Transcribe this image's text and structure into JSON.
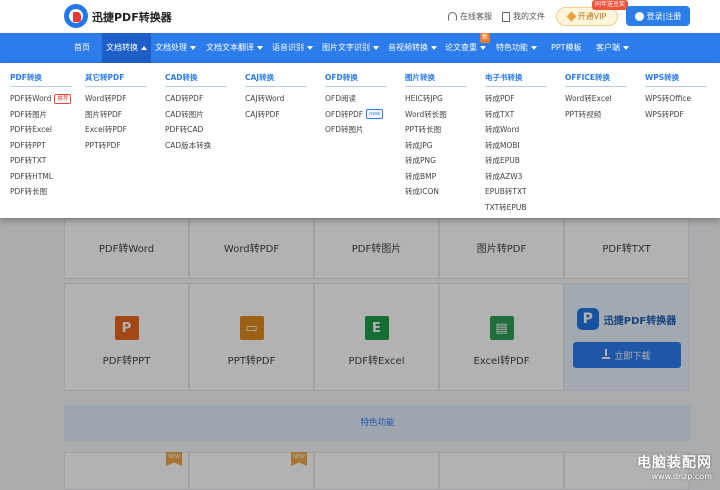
{
  "header": {
    "logo_text": "迅捷PDF转换器",
    "service_label": "在线客服",
    "files_label": "我的文件",
    "vip_label": "开通VIP",
    "vip_tag": "同年送豆奖",
    "login_label": "登录|注册"
  },
  "nav": {
    "items": [
      "首页",
      "文档转换",
      "文档处理",
      "文档文本翻译",
      "语音识别",
      "图片文字识别",
      "音视频转换",
      "论文查重",
      "特色功能",
      "PPT模板",
      "客户端"
    ],
    "new_badge": "新"
  },
  "dropdown": {
    "columns": [
      {
        "title": "PDF转换",
        "items": [
          "PDF转Word",
          "PDF转图片",
          "PDF转Excel",
          "PDF转PPT",
          "PDF转TXT",
          "PDF转HTML",
          "PDF转长图"
        ]
      },
      {
        "title": "其它转PDF",
        "items": [
          "Word转PDF",
          "图片转PDF",
          "Excel转PDF",
          "PPT转PDF"
        ]
      },
      {
        "title": "CAD转换",
        "items": [
          "CAD转PDF",
          "CAD转图片",
          "PDF转CAD",
          "CAD版本转换"
        ]
      },
      {
        "title": "CAJ转换",
        "items": [
          "CAJ转Word",
          "CAJ转PDF"
        ]
      },
      {
        "title": "OFD转换",
        "items": [
          "OFD阅读",
          "OFD转PDF",
          "OFD转图片"
        ]
      },
      {
        "title": "图片转换",
        "items": [
          "HEIC转JPG",
          "Word转长图",
          "PPT转长图",
          "转成JPG",
          "转成PNG",
          "转成BMP",
          "转成ICON"
        ]
      },
      {
        "title": "电子书转换",
        "items": [
          "转成PDF",
          "转成TXT",
          "转成Word",
          "转成MOBI",
          "转成EPUB",
          "转成AZW3",
          "EPUB转TXT",
          "TXT转EPUB"
        ]
      },
      {
        "title": "OFFICE转换",
        "items": [
          "Word转Excel",
          "PPT转视频"
        ]
      },
      {
        "title": "WPS转换",
        "items": [
          "WPS转Office",
          "WPS转PDF"
        ]
      }
    ],
    "hot_tag": "推荐",
    "new_tag": "new"
  },
  "tools": {
    "row1": [
      "PDF转Word",
      "Word转PDF",
      "PDF转图片",
      "图片转PDF",
      "PDF转TXT"
    ],
    "row2": [
      {
        "label": "PDF转PPT",
        "glyph": "P",
        "color": "#e8661f"
      },
      {
        "label": "PPT转PDF",
        "glyph": "▭",
        "color": "#e08a1e"
      },
      {
        "label": "PDF转Excel",
        "glyph": "E",
        "color": "#1e9c4a"
      },
      {
        "label": "Excel转PDF",
        "glyph": "▤",
        "color": "#2f9e57"
      }
    ],
    "row1_colors": [
      "#2d6fd6",
      "#e04a3a",
      "#2aa8e0",
      "#e6a020",
      "#2a9d8f"
    ],
    "bottom_new": "NEW",
    "bottom_colors": [
      "#2aa25a",
      "#2aa8e0",
      "#e8661f",
      "#e6a020",
      "#1e9c4a"
    ]
  },
  "promo": {
    "mark": "P",
    "name": "迅捷PDF转换器",
    "download_label": "立即下载"
  },
  "special_label": "特色功能",
  "watermark": {
    "line1": "电脑装配网",
    "line2": "www.dnzp.com"
  }
}
